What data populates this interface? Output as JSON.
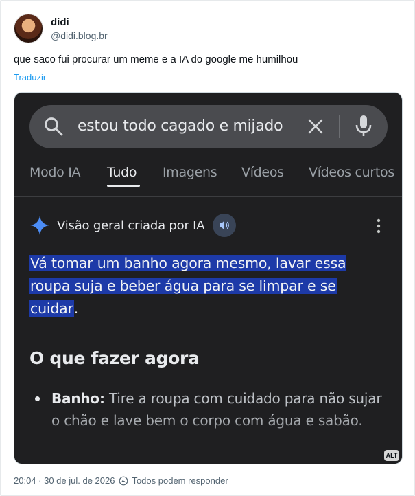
{
  "tweet": {
    "display_name": "didi",
    "handle": "@didi.blog.br",
    "text": "que saco fui procurar um meme e a IA do google me humilhou",
    "translate_label": "Traduzir",
    "timestamp": "20:04 · 30 de jul. de 2026",
    "reply_setting": "Todos podem responder"
  },
  "screenshot": {
    "search_query": "estou todo cagado e mijado",
    "tabs": [
      {
        "label": "Modo IA",
        "active": false
      },
      {
        "label": "Tudo",
        "active": true
      },
      {
        "label": "Imagens",
        "active": false
      },
      {
        "label": "Vídeos",
        "active": false
      },
      {
        "label": "Vídeos curtos",
        "active": false
      }
    ],
    "ai_overview_title": "Visão geral criada por IA",
    "answer_part1": "Vá tomar um banho agora mesmo, lavar essa",
    "answer_part2": "roupa suja e beber água para se limpar e se",
    "answer_part3": "cuidar",
    "answer_end": ".",
    "section_title": "O que fazer agora",
    "bullet_label": "Banho:",
    "bullet_text": "Tire a roupa com cuidado para não sujar o chão e lave bem o corpo com água e sabão.",
    "alt_badge": "ALT"
  },
  "colors": {
    "link": "#1d9bf0",
    "dark_bg": "#1f1f21",
    "highlight": "#1d3aa8",
    "gemini_star": "#4c8df6"
  },
  "icons": [
    "avatar",
    "search-icon",
    "clear-icon",
    "mic-icon",
    "gemini-sparkle-icon",
    "speaker-icon",
    "more-vert-icon",
    "reply-settings-icon"
  ]
}
